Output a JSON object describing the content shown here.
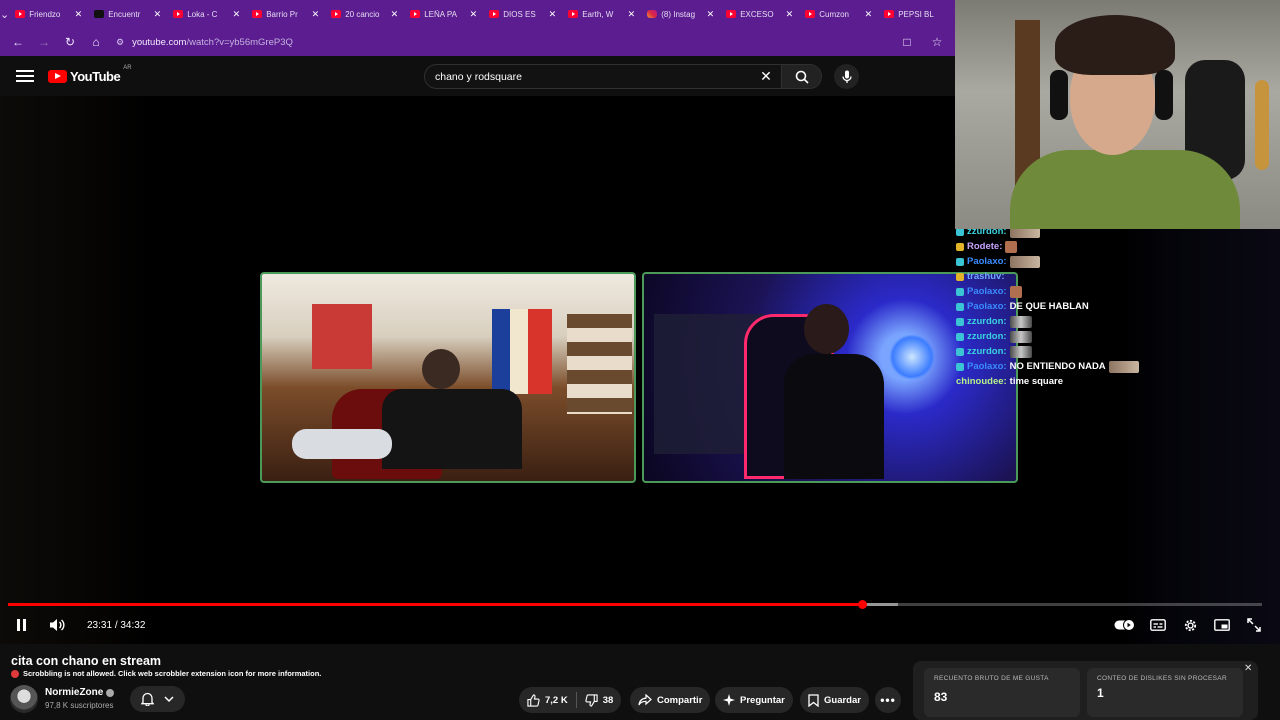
{
  "browser": {
    "tabs": [
      {
        "title": "Friendzo",
        "icon": "youtube-icon"
      },
      {
        "title": "Encuentr",
        "icon": "tiktok-icon"
      },
      {
        "title": "Loka - C",
        "icon": "youtube-icon"
      },
      {
        "title": "Barrio Pr",
        "icon": "youtube-icon"
      },
      {
        "title": "20 cancio",
        "icon": "youtube-icon"
      },
      {
        "title": "LEÑA PA",
        "icon": "youtube-icon"
      },
      {
        "title": "DIOS ES",
        "icon": "youtube-icon"
      },
      {
        "title": "Earth, W",
        "icon": "youtube-icon"
      },
      {
        "title": "(8) Instag",
        "icon": "instagram-icon"
      },
      {
        "title": "EXCESO",
        "icon": "youtube-icon"
      },
      {
        "title": "Cumzon",
        "icon": "youtube-icon"
      },
      {
        "title": "PEPSI BL",
        "icon": "youtube-icon"
      }
    ],
    "url_host": "youtube.com",
    "url_path": "/watch?v=yb56mGreP3Q",
    "chrome_color": "#5b1d8f"
  },
  "youtube": {
    "logo_text": "YouTube",
    "country_code": "AR",
    "search_query": "chano y rodsquare"
  },
  "chat": [
    {
      "user": "zzurdon:",
      "color": "#3ad3e0",
      "text": "",
      "badge": "teal",
      "emote": "emote"
    },
    {
      "user": "Rodete:",
      "color": "#c8a2ff",
      "text": "",
      "badge": "crown",
      "emote": "sm"
    },
    {
      "user": "Paolaxo:",
      "color": "#3a8cff",
      "text": "",
      "badge": "teal",
      "emote": "emote"
    },
    {
      "user": "trashuv:",
      "color": "#6fa8ff",
      "text": "",
      "badge": "crown",
      "emote": ""
    },
    {
      "user": "Paolaxo:",
      "color": "#3a8cff",
      "text": "",
      "badge": "teal",
      "emote": "sm"
    },
    {
      "user": "Paolaxo:",
      "color": "#3a8cff",
      "text": "DE QUE HABLAN",
      "badge": "teal",
      "emote": ""
    },
    {
      "user": "zzurdon:",
      "color": "#3ad3e0",
      "text": "",
      "badge": "teal",
      "emote": "face"
    },
    {
      "user": "zzurdon:",
      "color": "#3ad3e0",
      "text": "",
      "badge": "teal",
      "emote": "face"
    },
    {
      "user": "zzurdon:",
      "color": "#3ad3e0",
      "text": "",
      "badge": "teal",
      "emote": "face"
    },
    {
      "user": "Paolaxo:",
      "color": "#3a8cff",
      "text": "NO ENTIENDO NADA",
      "badge": "teal",
      "emote": "emote"
    },
    {
      "user": "chinoudee:",
      "color": "#b6f08a",
      "text": "time square",
      "badge": "",
      "emote": ""
    }
  ],
  "player": {
    "current_time": "23:31",
    "duration": "34:32",
    "time_separator": "/",
    "played_fraction": 0.681,
    "buffered_fraction": 0.71,
    "progress_color": "#ff0000"
  },
  "video": {
    "title": "cita con chano en stream",
    "scrobble_notice": "Scrobbling is not allowed. Click web scrobbler extension icon for more information.",
    "channel_name": "NormieZone",
    "subscribers": "97,8 K suscriptores",
    "likes": "7,2 K",
    "dislikes": "38",
    "share_label": "Compartir",
    "ask_label": "Preguntar",
    "save_label": "Guardar"
  },
  "dislike_panel": {
    "raw_likes_label": "RECUENTO BRUTO DE ME GUSTA",
    "raw_likes_value": "83",
    "dislikes_label": "CONTEO DE DISLIKES SIN PROCESAR",
    "dislikes_value": "1"
  }
}
